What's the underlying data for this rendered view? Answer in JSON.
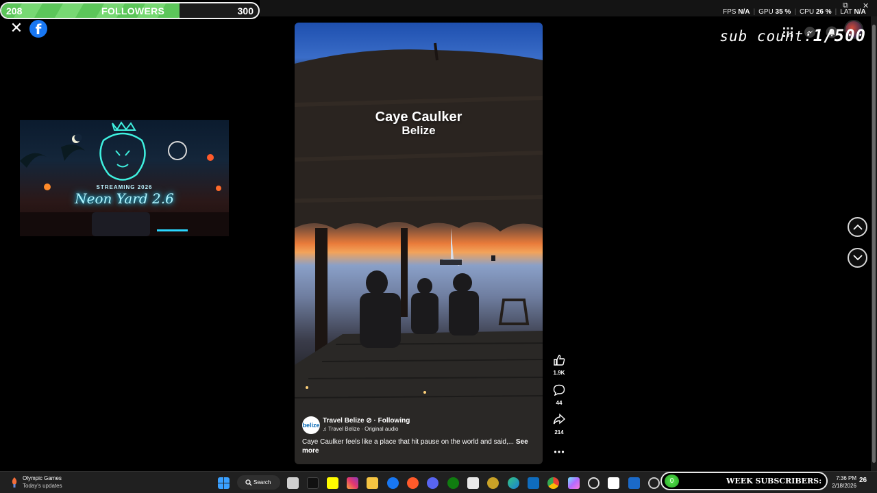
{
  "followers_bar": {
    "current": "208",
    "label": "FOLLOWERS",
    "goal": "300",
    "progress": 0.693,
    "fill_color": "#5cc65a"
  },
  "perf_overlay": {
    "fps_label": "FPS",
    "fps_value": "N/A",
    "gpu_label": "GPU",
    "gpu_value": "35 %",
    "cpu_label": "CPU",
    "cpu_value": "26 %",
    "lat_label": "LAT",
    "lat_value": "N/A"
  },
  "sub_count": {
    "label": "sub count:",
    "value": "1/500"
  },
  "header_icons": [
    "apps-grid-icon",
    "messenger-icon",
    "bell-icon",
    "profile-avatar"
  ],
  "left": {
    "close_icon": "close-icon",
    "logo": "facebook-logo"
  },
  "neon_card": {
    "top_line": "STREAMING 2026",
    "title": "Neon Yard 2.6"
  },
  "video": {
    "title": "Caye Caulker",
    "subtitle": "Belize",
    "author": {
      "avatar_text": "belize",
      "name": "Travel Belize",
      "follow": "· Following",
      "audio": "♫ Travel Belize · Original audio"
    },
    "caption": "Caye Caulker feels like a place that hit pause on the world and said,...",
    "see_more": "See more"
  },
  "actions": [
    {
      "icon": "like-icon",
      "count": "1.9K"
    },
    {
      "icon": "comment-icon",
      "count": "44"
    },
    {
      "icon": "share-icon",
      "count": "214"
    },
    {
      "icon": "more-icon",
      "count": ""
    }
  ],
  "navigation": {
    "up": "chevron-up-icon",
    "down": "chevron-down-icon"
  },
  "taskbar": {
    "news_title": "Olympic Games",
    "news_sub": "Today's updates",
    "search_label": "Search",
    "week_subscribers_label": "WEEK SUBSCRIBERS:",
    "week_subscribers_count": "0",
    "time": "7:36 PM",
    "date": "2/18/2026",
    "notification_count": "26"
  }
}
